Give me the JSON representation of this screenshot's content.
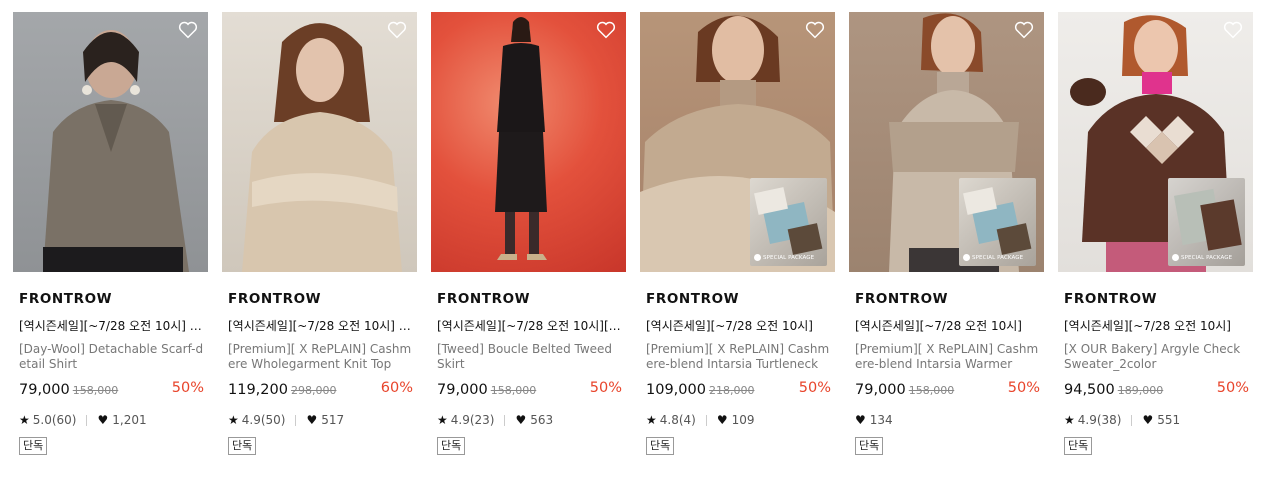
{
  "products": [
    {
      "brand": "FRONTROW",
      "promo": "[역시즌세일][~7/28 오전 10시] | [...",
      "name": "[Day-Wool] Detachable Scarf-detail Shirt",
      "price": "79,000",
      "original_price": "158,000",
      "discount": "50%",
      "rating": "5.0(60)",
      "likes": "1,201",
      "badge": "단독",
      "has_package": false,
      "bg_color": "#9ea1a4"
    },
    {
      "brand": "FRONTROW",
      "promo": "[역시즌세일][~7/28 오전 10시] | [...",
      "name": "[Premium][ X RePLAIN] Cashmere Wholegarment Knit Top",
      "price": "119,200",
      "original_price": "298,000",
      "discount": "60%",
      "rating": "4.9(50)",
      "likes": "517",
      "badge": "단독",
      "has_package": false,
      "bg_color": "#d9d3c9"
    },
    {
      "brand": "FRONTROW",
      "promo": "[역시즌세일][~7/28 오전 10시][기...",
      "name": "[Tweed] Boucle Belted Tweed Skirt",
      "price": "79,000",
      "original_price": "158,000",
      "discount": "50%",
      "rating": "4.9(23)",
      "likes": "563",
      "badge": "단독",
      "has_package": false,
      "bg_color": "#e2523e"
    },
    {
      "brand": "FRONTROW",
      "promo": "[역시즌세일][~7/28 오전 10시]",
      "name": "[Premium][ X RePLAIN] Cashmere-blend Intarsia Turtleneck",
      "price": "109,000",
      "original_price": "218,000",
      "discount": "50%",
      "rating": "4.8(4)",
      "likes": "109",
      "badge": "단독",
      "has_package": true,
      "package_label": "SPECIAL PACKAGE",
      "bg_color": "#b08e75"
    },
    {
      "brand": "FRONTROW",
      "promo": "[역시즌세일][~7/28 오전 10시]",
      "name": "[Premium][ X RePLAIN] Cashmere-blend Intarsia Warmer",
      "price": "79,000",
      "original_price": "158,000",
      "discount": "50%",
      "rating": "",
      "likes": "134",
      "badge": "단독",
      "has_package": true,
      "package_label": "SPECIAL PACKAGE",
      "bg_color": "#a88f7a"
    },
    {
      "brand": "FRONTROW",
      "promo": "[역시즌세일][~7/28 오전 10시]",
      "name": "[X OUR Bakery] Argyle Check Sweater_2color",
      "price": "94,500",
      "original_price": "189,000",
      "discount": "50%",
      "rating": "4.9(38)",
      "likes": "551",
      "badge": "단독",
      "has_package": true,
      "package_label": "SPECIAL PACKAGE",
      "bg_color": "#ebe9e6"
    }
  ],
  "icons": {
    "wishlist": "heart-outline-icon",
    "rating": "star-icon",
    "likes": "heart-filled-icon"
  },
  "colors": {
    "discount": "#e8452c",
    "text": "#111111",
    "muted": "#777777"
  }
}
